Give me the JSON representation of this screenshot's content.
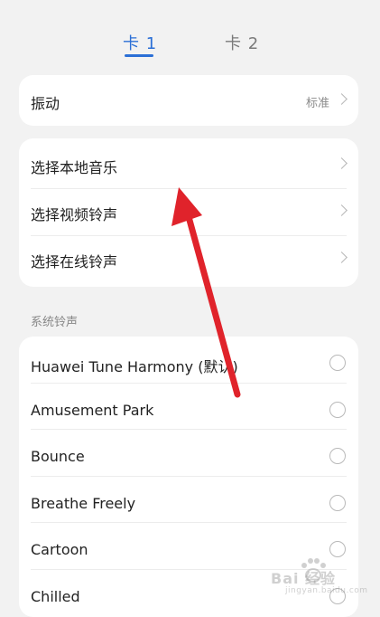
{
  "tabs": [
    {
      "label": "卡 1",
      "active": true
    },
    {
      "label": "卡 2",
      "active": false
    }
  ],
  "accent_color": "#2b6fd6",
  "vibration": {
    "label": "振动",
    "value": "标准",
    "icon": "chevron-right-icon"
  },
  "choose_items": [
    {
      "label": "选择本地音乐",
      "icon": "chevron-right-icon"
    },
    {
      "label": "选择视频铃声",
      "icon": "chevron-right-icon"
    },
    {
      "label": "选择在线铃声",
      "icon": "chevron-right-icon"
    }
  ],
  "system_section_title": "系统铃声",
  "ringtones": [
    {
      "label": "Huawei Tune Harmony (默认)",
      "selected": false
    },
    {
      "label": "Amusement Park",
      "selected": false
    },
    {
      "label": "Bounce",
      "selected": false
    },
    {
      "label": "Breathe Freely",
      "selected": false
    },
    {
      "label": "Cartoon",
      "selected": false
    },
    {
      "label": "Chilled",
      "selected": false
    }
  ],
  "annotation": {
    "color": "#e0232b",
    "icon": "red-arrow-annotation"
  },
  "watermark": {
    "text": "Bai 经验",
    "sub": "jingyan.baidu.com"
  }
}
